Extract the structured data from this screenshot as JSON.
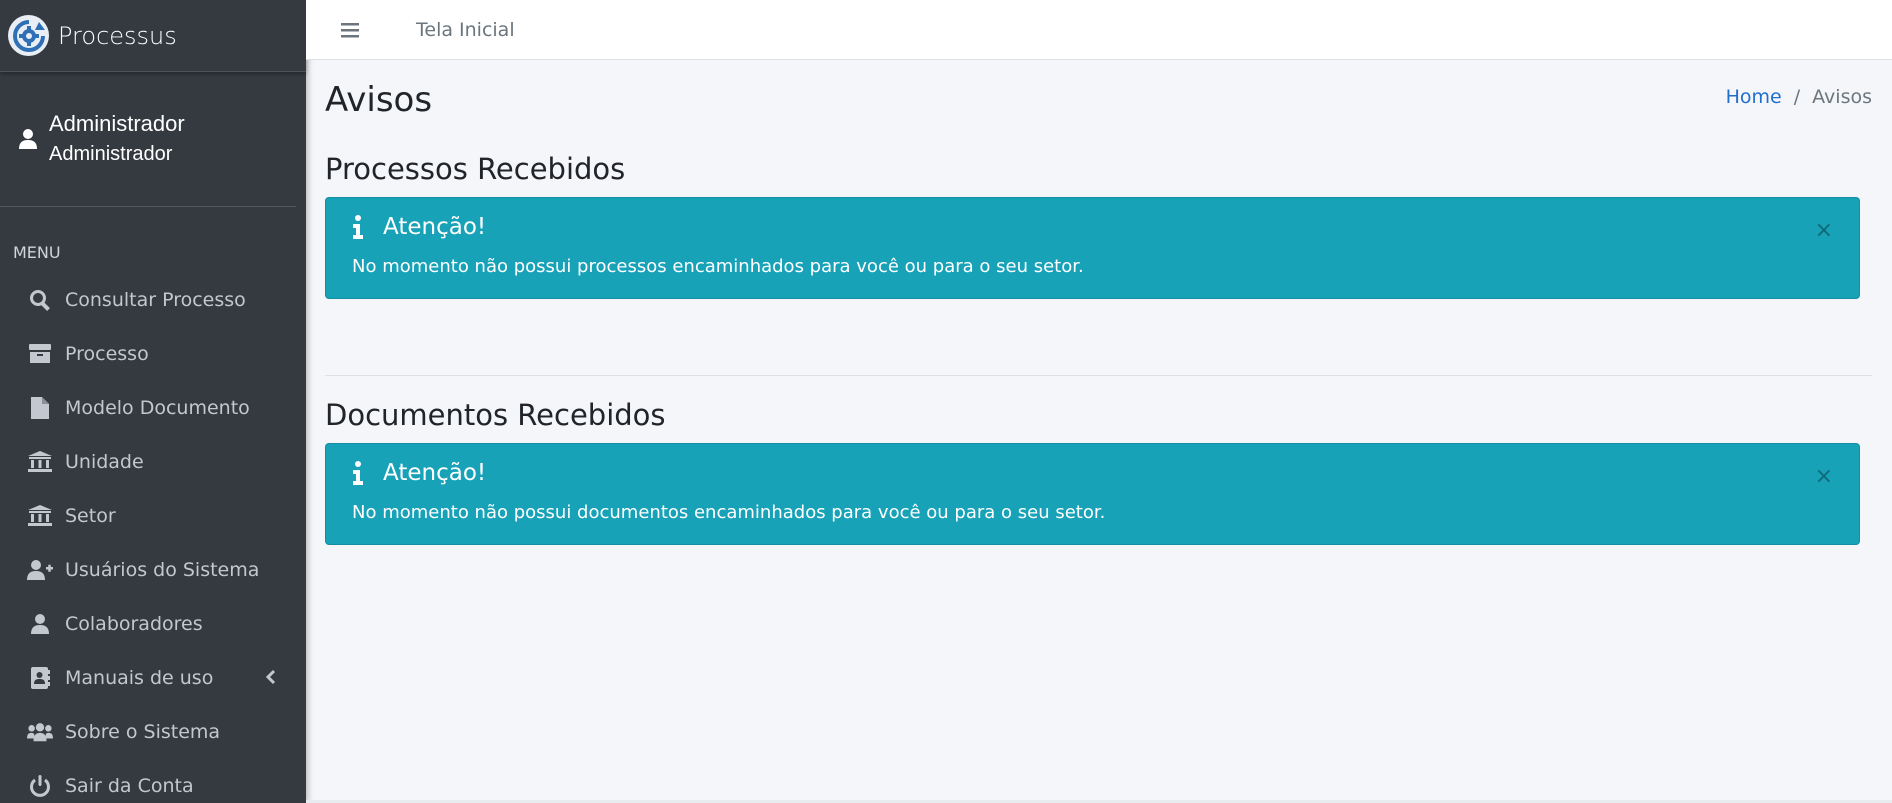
{
  "brand": {
    "name": "Processus"
  },
  "user": {
    "name": "Administrador",
    "role": "Administrador"
  },
  "menu": {
    "header": "MENU",
    "items": [
      {
        "label": "Consultar Processo",
        "icon": "search-icon"
      },
      {
        "label": "Processo",
        "icon": "archive-icon"
      },
      {
        "label": "Modelo Documento",
        "icon": "file-icon"
      },
      {
        "label": "Unidade",
        "icon": "landmark-icon"
      },
      {
        "label": "Setor",
        "icon": "landmark-icon"
      },
      {
        "label": "Usuários do Sistema",
        "icon": "user-plus-icon"
      },
      {
        "label": "Colaboradores",
        "icon": "user-icon"
      },
      {
        "label": "Manuais de uso",
        "icon": "address-book-icon",
        "expandable": true
      },
      {
        "label": "Sobre o Sistema",
        "icon": "users-icon"
      },
      {
        "label": "Sair da Conta",
        "icon": "power-icon"
      }
    ]
  },
  "topbar": {
    "home_link": "Tela Inicial"
  },
  "page": {
    "title": "Avisos",
    "breadcrumb": {
      "home": "Home",
      "separator": "/",
      "current": "Avisos"
    }
  },
  "sections": [
    {
      "title": "Processos Recebidos",
      "alert": {
        "title": "Atenção!",
        "message": "No momento não possui processos encaminhados para você ou para o seu setor.",
        "close": "×"
      }
    },
    {
      "title": "Documentos Recebidos",
      "alert": {
        "title": "Atenção!",
        "message": "No momento não possui documentos encaminhados para você ou para o seu setor.",
        "close": "×"
      }
    }
  ],
  "colors": {
    "sidebar_bg": "#343a40",
    "content_bg": "#f4f6f9",
    "alert_info": "#17a2b8",
    "link": "#1f6fd0"
  }
}
